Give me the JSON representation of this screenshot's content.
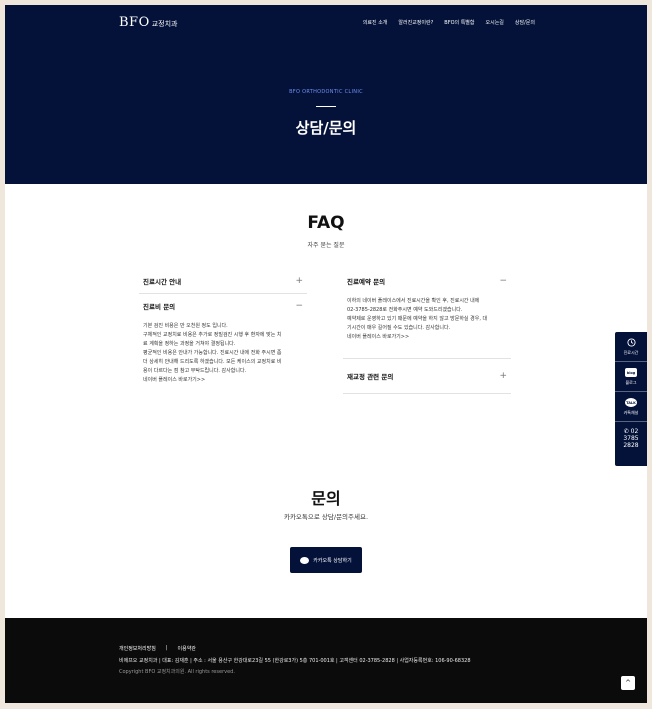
{
  "header": {
    "logo_text": "BFO",
    "logo_sub": "교정치과",
    "nav": [
      "의료진 소개",
      "알러진교정이란?",
      "BFO의 특별함",
      "오시는길",
      "상담/문의"
    ]
  },
  "hero": {
    "subtitle": "BFO ORTHODONTIC CLINIC",
    "title": "상담/문의"
  },
  "faq": {
    "title": "FAQ",
    "subtitle": "자주 묻는 질문",
    "left": [
      {
        "question": "진료시간 안내",
        "sign": "+",
        "answer": []
      },
      {
        "question": "진료비 문의",
        "sign": "−",
        "answer": [
          "기본 검진 비용은 만 오천원 정도 입니다.",
          "구체적인 교정치료 비용은 추가로 정밀검진 시행 후 환자에 맞는 치",
          "료 계획을 정하는 과정을 거쳐야 결정됩니다.",
          "평균적인 비용은 안내가 가능합니다. 진료시간 내에 전화 주시면 좀",
          "더 상세히 안내해 드리도록 하겠습니다. 모든 케이스의 교정치료 비",
          "용이 다르다는 점 참고 부탁드립니다. 감사합니다.",
          "네이버 플레이스 바로가기>>"
        ]
      }
    ],
    "right": [
      {
        "question": "진료예약 문의",
        "sign": "−",
        "answer": [
          "이하의 네이버 플레이스에서 진료시간을 확인 후, 진료시간 내에",
          "02-3785-2828로 전화주시면 예약 도와드리겠습니다.",
          "예약제로 운영하고 있기 때문에 예약을 하지 않고 방문하실 경우, 대",
          "기시간이 매우 길어질 수도 있습니다. 감사합니다.",
          "네이버 플레이스 바로가기>>"
        ]
      },
      {
        "question": "재교정 관련 문의",
        "sign": "+",
        "answer": []
      }
    ]
  },
  "inquiry": {
    "title": "문의",
    "subtitle": "카카오톡으로 상담/문의주세요.",
    "button": "카카오톡 상담하기"
  },
  "footer": {
    "links": [
      "개인정보처리방침",
      "|",
      "이용약관"
    ],
    "info": "비에프오 교정치과 | 대표: 김재훈 | 주소 : 서울 용산구 한강대로23길 55 (한강로3가) 5층 701-001호 | 고객센터 02-3785-2828 | 사업자등록번호: 106-90-68328",
    "copyright": "Copyright BFO 교정치과의원. All rights reserved.",
    "top_button": "^"
  },
  "quick": {
    "items": [
      {
        "icon": "clock-icon",
        "label": "진료시간"
      },
      {
        "icon": "blog-icon",
        "icon_text": "blog",
        "label": "블로그"
      },
      {
        "icon": "kakaotalk-icon",
        "icon_text": "TALK",
        "label": "카톡채널"
      }
    ],
    "phone_lines": [
      "02",
      "3785",
      "2828"
    ]
  },
  "colors": {
    "navy": "#04123a",
    "accent_blue": "#6f8ff0",
    "footer_bg": "#0b0b0b",
    "page_bg": "#efe6dc"
  }
}
